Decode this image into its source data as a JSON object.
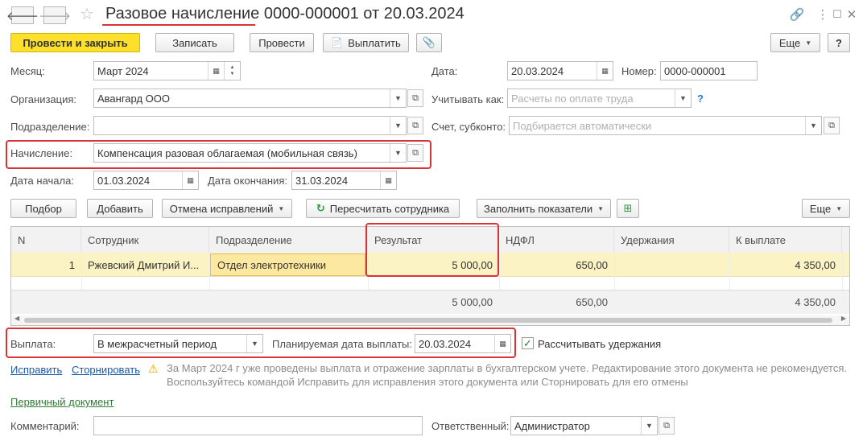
{
  "title": "Разовое начисление 0000-000001 от 20.03.2024",
  "toolbar": {
    "post_close": "Провести и закрыть",
    "save": "Записать",
    "post": "Провести",
    "pay": "Выплатить",
    "more": "Еще",
    "help": "?"
  },
  "form": {
    "month_label": "Месяц:",
    "month_value": "Март 2024",
    "date_label": "Дата:",
    "date_value": "20.03.2024",
    "number_label": "Номер:",
    "number_value": "0000-000001",
    "org_label": "Организация:",
    "org_value": "Авангард ООО",
    "account_as_label": "Учитывать как:",
    "account_as_placeholder": "Расчеты по оплате труда",
    "dept_label": "Подразделение:",
    "subconto_label": "Счет, субконто:",
    "subconto_placeholder": "Подбирается автоматически",
    "accrual_label": "Начисление:",
    "accrual_value": "Компенсация разовая облагаемая (мобильная связь)",
    "start_label": "Дата начала:",
    "start_value": "01.03.2024",
    "end_label": "Дата окончания:",
    "end_value": "31.03.2024"
  },
  "table_toolbar": {
    "select": "Подбор",
    "add": "Добавить",
    "cancel_corrections": "Отмена исправлений",
    "recalc": "Пересчитать сотрудника",
    "fill": "Заполнить показатели",
    "more": "Еще"
  },
  "table": {
    "headers": [
      "N",
      "Сотрудник",
      "Подразделение",
      "Результат",
      "НДФЛ",
      "Удержания",
      "К выплате"
    ],
    "rows": [
      {
        "n": "1",
        "employee": "Ржевский Дмитрий И...",
        "dept": "Отдел электротехники",
        "result": "5 000,00",
        "ndfl": "650,00",
        "deductions": "",
        "payout": "4 350,00"
      }
    ],
    "totals": {
      "result": "5 000,00",
      "ndfl": "650,00",
      "payout": "4 350,00"
    }
  },
  "payment": {
    "label": "Выплата:",
    "value": "В межрасчетный период",
    "planned_label": "Планируемая дата выплаты:",
    "planned_value": "20.03.2024",
    "calc_deductions_label": "Рассчитывать удержания",
    "calc_deductions_checked": true
  },
  "links": {
    "fix": "Исправить",
    "reverse": "Сторнировать",
    "primary_doc": "Первичный документ"
  },
  "warning": {
    "line1": "За Март 2024 г уже проведены выплата и отражение зарплаты в бухгалтерском учете. Редактирование этого документа не рекомендуется.",
    "line2": "Воспользуйтесь командой Исправить для исправления этого документа или Сторнировать для его отмены"
  },
  "footer": {
    "comment_label": "Комментарий:",
    "responsible_label": "Ответственный:",
    "responsible_value": "Администратор"
  },
  "colors": {
    "accent_yellow": "#fce02b",
    "highlight_red": "#d93333",
    "selected_row": "#fbf3c4",
    "link_blue": "#1a5aa8",
    "link_green": "#2e7d32"
  }
}
